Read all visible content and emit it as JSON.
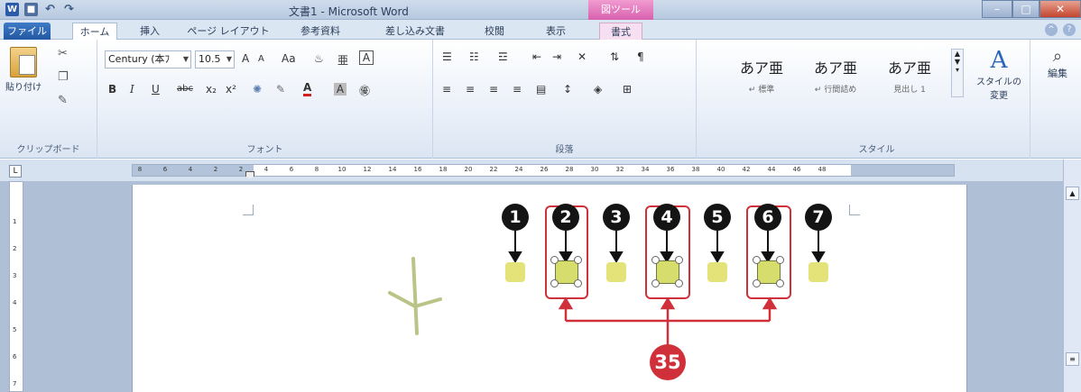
{
  "window": {
    "title": "文書1 - Microsoft Word",
    "contextual_tab_group": "図ツール",
    "app_icon_letter": "W"
  },
  "tabs": [
    "ファイル",
    "ホーム",
    "挿入",
    "ページ レイアウト",
    "参考資料",
    "差し込み文書",
    "校閲",
    "表示",
    "書式"
  ],
  "ribbon": {
    "clipboard": {
      "paste_label": "貼り付け",
      "group_label": "クリップボード"
    },
    "font": {
      "font_name": "Century (本ﾌ",
      "font_size": "10.5",
      "group_label": "フォント",
      "bold": "B",
      "italic": "I",
      "underline": "U",
      "strike": "abc",
      "subscript": "x₂",
      "superscript": "x²",
      "font_color": "A",
      "grow": "A",
      "shrink": "A",
      "case": "Aa"
    },
    "paragraph": {
      "group_label": "段落"
    },
    "styles": {
      "group_label": "スタイル",
      "items": [
        {
          "preview": "あア亜",
          "name": "↵ 標準"
        },
        {
          "preview": "あア亜",
          "name": "↵ 行間詰め"
        },
        {
          "preview": "あア亜",
          "name": "見出し 1"
        }
      ],
      "change_styles_label": "スタイルの変更"
    },
    "editing": {
      "label": "編集"
    }
  },
  "ruler": {
    "corner": "L",
    "ticks": [
      "8",
      "6",
      "4",
      "2",
      "2",
      "4",
      "6",
      "8",
      "10",
      "12",
      "14",
      "16",
      "18",
      "20",
      "22",
      "24",
      "26",
      "28",
      "30",
      "32",
      "34",
      "36",
      "38",
      "40",
      "42",
      "44",
      "46",
      "48"
    ],
    "vticks": [
      "1",
      "2",
      "3",
      "4",
      "5",
      "6",
      "7"
    ]
  },
  "annotations": {
    "steps": [
      "1",
      "2",
      "3",
      "4",
      "5",
      "6",
      "7"
    ],
    "group_badge": "35",
    "colors": {
      "step_badge": "#141414",
      "highlight": "#d0303a",
      "glyph": "#e3e37a"
    }
  }
}
